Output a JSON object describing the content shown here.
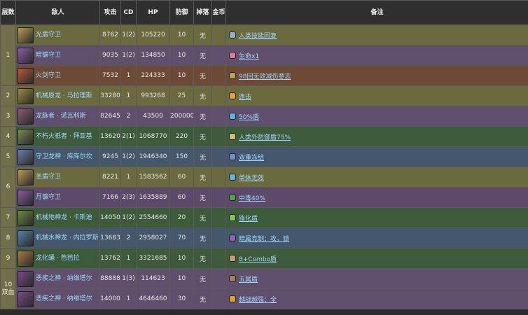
{
  "headers": {
    "floor": "层数",
    "enemy": "敌人",
    "attack": "攻击",
    "cd": "CD",
    "hp": "HP",
    "defense": "防御",
    "drop": "掉落",
    "coin": "金币",
    "note": "备注"
  },
  "floors": {
    "f1": "1",
    "f2": "2",
    "f3": "3",
    "f4": "4",
    "f5": "5",
    "f6": "6",
    "f7": "7",
    "f8": "8",
    "f9": "9",
    "f10": "10 双血"
  },
  "rows": [
    {
      "enemy": "光盾守卫",
      "attack": "8762",
      "cd": "1(2)",
      "hp": "105220",
      "defense": "10",
      "drop": "无",
      "note": "人类技能回复",
      "avatar_color": "#b89a55",
      "icon_color": "#8fb0d0"
    },
    {
      "enemy": "暗镰守卫",
      "attack": "9035",
      "cd": "1(2)",
      "hp": "134850",
      "defense": "10",
      "drop": "无",
      "note": "生命ⅹ1",
      "avatar_color": "#8a5ca0",
      "icon_color": "#d07fa0"
    },
    {
      "enemy": "火剑守卫",
      "attack": "7532",
      "cd": "1",
      "hp": "224333",
      "defense": "10",
      "drop": "无",
      "note": "98回无效减伤意志",
      "avatar_color": "#b55a3a",
      "icon_color": "#c0a060"
    },
    {
      "enemy": "机械原龙 · 马拉理斯",
      "attack": "33280",
      "cd": "1",
      "hp": "993268",
      "defense": "25",
      "drop": "无",
      "note": "连击",
      "avatar_color": "#a08a40",
      "icon_color": "#e0a040"
    },
    {
      "enemy": "龙脉者 · 诺瓦利斯",
      "attack": "82645",
      "cd": "2",
      "hp": "43500",
      "defense": "200000",
      "drop": "无",
      "note": "50%盾",
      "avatar_color": "#8a5a6a",
      "icon_color": "#60b0e0"
    },
    {
      "enemy": "不朽火祇者 · 拜亚基",
      "attack": "13620",
      "cd": "2(1)",
      "hp": "1068770",
      "defense": "220",
      "drop": "无",
      "note": "人类外防御盾75%",
      "avatar_color": "#7a8a50",
      "icon_color": "#d0c080"
    },
    {
      "enemy": "守卫龙神 · 库库尔坎",
      "attack": "9245",
      "cd": "1(2)",
      "hp": "1946340",
      "defense": "150",
      "drop": "无",
      "note": "双重冻结",
      "avatar_color": "#6a7ea8",
      "icon_color": "#7090d0"
    },
    {
      "enemy": "圣盾守卫",
      "attack": "8221",
      "cd": "1",
      "hp": "1583562",
      "defense": "60",
      "drop": "无",
      "note": "单体无效",
      "avatar_color": "#b89a55",
      "icon_color": "#60b0e0"
    },
    {
      "enemy": "月镰守卫",
      "attack": "7166",
      "cd": "2(3)",
      "hp": "1635889",
      "defense": "60",
      "drop": "无",
      "note": "中毒40%",
      "avatar_color": "#8a5ca0",
      "icon_color": "#50a050"
    },
    {
      "enemy": "机械地神龙 · 卡斯迪",
      "attack": "14050",
      "cd": "1(2)",
      "hp": "2554660",
      "defense": "20",
      "drop": "无",
      "note": "锋化盾",
      "avatar_color": "#6a8a40",
      "icon_color": "#80c060"
    },
    {
      "enemy": "机械水神龙 · 内拉罗斯",
      "attack": "13683",
      "cd": "2",
      "hp": "2958027",
      "defense": "70",
      "drop": "无",
      "note": "暗属克制：攻，锁",
      "avatar_color": "#5a80a8",
      "icon_color": "#9060c0"
    },
    {
      "enemy": "龙化蛹 · 芭芭拉",
      "attack": "13762",
      "cd": "1",
      "hp": "3321685",
      "defense": "10",
      "drop": "无",
      "note": "8+Combo盾",
      "avatar_color": "#a87a40",
      "icon_color": "#c0a070"
    },
    {
      "enemy": "恶疾之神 · 纳维塔尔",
      "attack": "88888",
      "cd": "1(3)",
      "hp": "114623",
      "defense": "10",
      "drop": "无",
      "note": "五属盾",
      "avatar_color": "#7a4a8a",
      "icon_color": "#a08060"
    },
    {
      "enemy": "恶疾之神 · 纳维塔尔",
      "attack": "14000",
      "cd": "1",
      "hp": "4646460",
      "defense": "30",
      "drop": "无",
      "note": "越战越强：全",
      "avatar_color": "#7a4a8a",
      "icon_color": "#e0a030"
    }
  ]
}
